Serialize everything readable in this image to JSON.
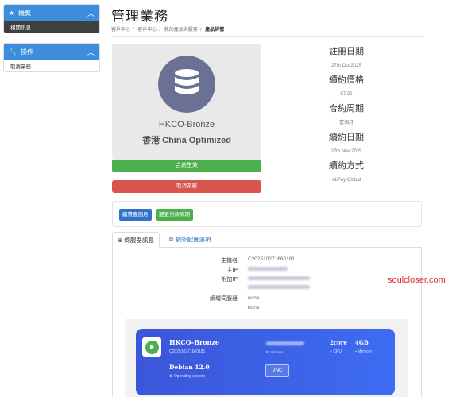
{
  "sidebar": {
    "overview": {
      "title": "概覧",
      "items": [
        "相關訊息"
      ]
    },
    "actions": {
      "title": "操作",
      "items": [
        "取消業務"
      ]
    }
  },
  "page": {
    "title": "管理業務",
    "breadcrumbs": [
      "客戶中心",
      "客戶中心",
      "我的產品與服務",
      "產品詳情"
    ]
  },
  "product": {
    "name": "HKCO-Bronze",
    "subtitle": "香港 China Optimized",
    "status_label": "合約生效",
    "cancel_label": "取消業務"
  },
  "info": [
    {
      "label": "註冊日期",
      "value": "27th Oct 2025"
    },
    {
      "label": "續約價格",
      "value": "$7.20"
    },
    {
      "label": "合約周期",
      "value": "壹個月"
    },
    {
      "label": "續約日期",
      "value": "27th Nov 2025"
    },
    {
      "label": "續約方式",
      "value": "AliPay Global"
    }
  ],
  "actions": {
    "renew_label": "續費壹個月",
    "change_cycle_label": "變更付款周期"
  },
  "tabs": {
    "server_info": "伺服器訊息",
    "extra_options": "額外配置選項"
  },
  "server": {
    "hostname_label": "主機名",
    "hostname": "C202510271660181",
    "main_ip_label": "主IP",
    "extra_ip_label": "附加IP",
    "nameserver_label": "網域伺服器",
    "ns1": "none",
    "ns2": "none"
  },
  "vps_card": {
    "name": "HKCO-Bronze",
    "service_id": "C202510271660181",
    "os": "Debian 12.0",
    "os_label": "Operating system",
    "ip_label": "IP address",
    "cpu": "2core",
    "cpu_label": "CPU",
    "memory": "4GB",
    "memory_label": "Memory",
    "vnc_label": "VNC"
  },
  "watermark": "soulcloser.com",
  "colors": {
    "primary": "#3c8dde",
    "success": "#4cae4c",
    "danger": "#d9534f",
    "card_blue": "#3d5fe6"
  }
}
